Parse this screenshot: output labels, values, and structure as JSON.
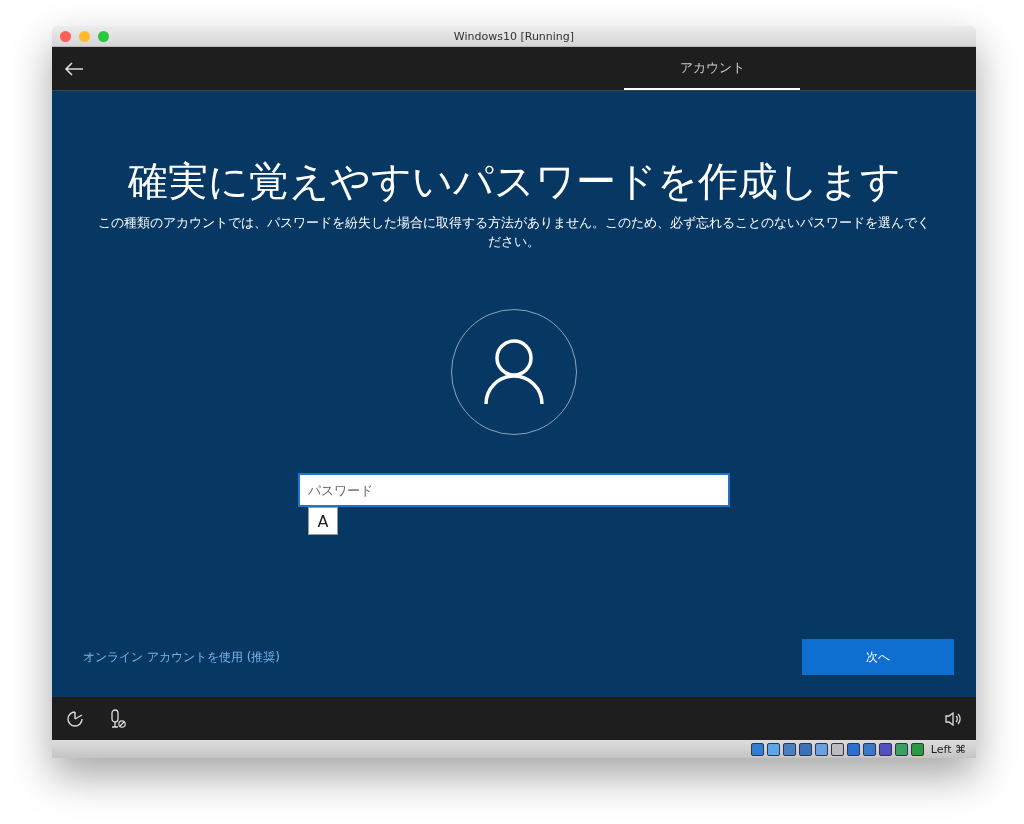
{
  "window": {
    "title": "Windows10 [Running]"
  },
  "header": {
    "tabs": [
      {
        "label": "アカウント",
        "selected": true
      }
    ]
  },
  "heading": "確実に覚えやすいパスワードを作成します",
  "description": "この種類のアカウントでは、パスワードを紛失した場合に取得する方法がありません。このため、必ず忘れることのないパスワードを選んでください。",
  "password_field": {
    "placeholder": "パスワード"
  },
  "ime_indicator": "A",
  "online_account_link": "オンライン アカウントを使用 (推奨)",
  "next_button": "次へ",
  "status_bar": {
    "host_key": "Left ⌘"
  }
}
